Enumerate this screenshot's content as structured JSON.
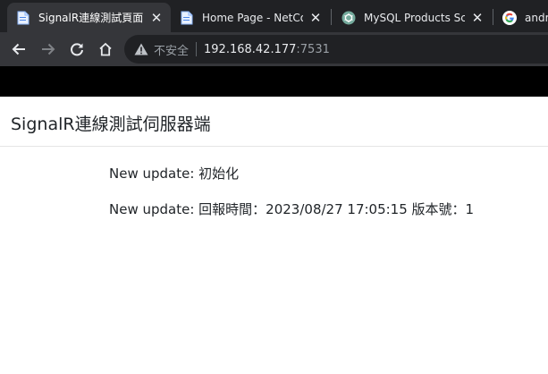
{
  "browser": {
    "tabs": [
      {
        "title": "SignalR連線測試頁面",
        "active": true,
        "icon": "document-icon"
      },
      {
        "title": "Home Page - NetCo",
        "active": false,
        "icon": "document-icon"
      },
      {
        "title": "MySQL Products Sch",
        "active": false,
        "icon": "chatgpt-icon"
      },
      {
        "title": "andr",
        "active": false,
        "icon": "google-icon"
      }
    ],
    "close_glyph": "✕",
    "address": {
      "security_label": "不安全",
      "host": "192.168.42.177",
      "port": ":7531"
    }
  },
  "page": {
    "brand": "SignalR連線測試伺服器端",
    "messages": [
      {
        "prefix": "New update:",
        "text": "初始化"
      },
      {
        "prefix": "New update:",
        "text": "回報時間：2023/08/27 17:05:15 版本號：1"
      }
    ]
  },
  "colors": {
    "tabbar_bg": "#202124",
    "toolbar_bg": "#35363a",
    "bookmarkbar_bg": "#000000",
    "page_bg": "#ffffff",
    "text": "#212529"
  }
}
